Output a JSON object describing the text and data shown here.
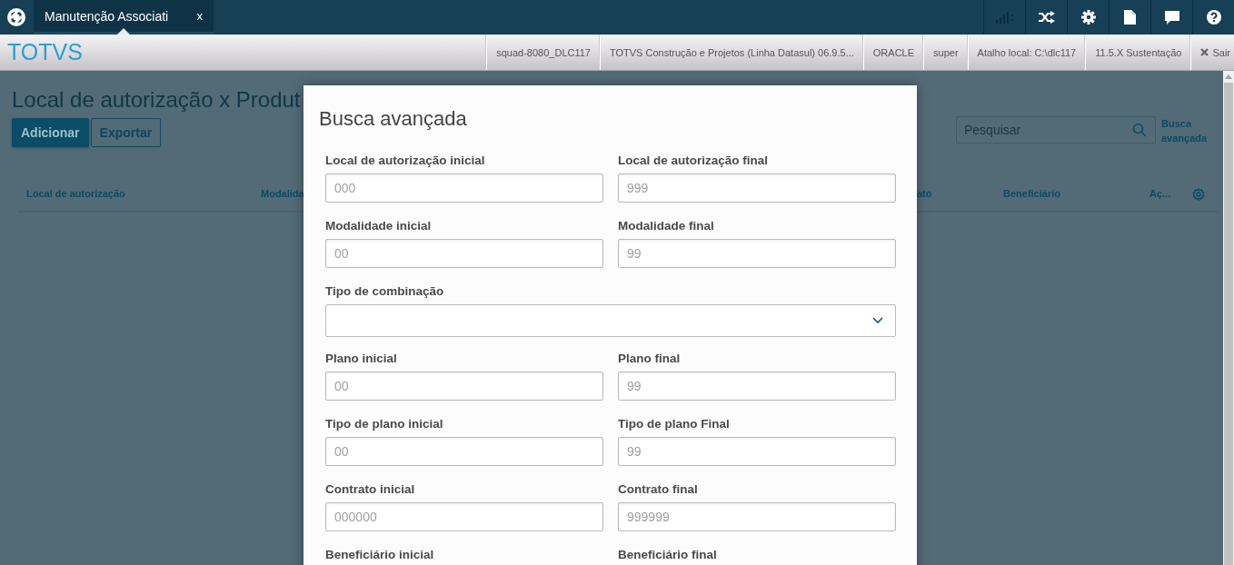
{
  "top_bar": {
    "tabs": [
      {
        "label": "Manutenção Associati",
        "close": "x",
        "selected": true
      }
    ]
  },
  "info_bar": {
    "brand": "TOTVS",
    "items": [
      "squad-8080_DLC117",
      "TOTVS Construção e Projetos (Linha Datasul) 06.9.5...",
      "ORACLE",
      "super",
      "Atalho local: C:\\dlc117",
      "11.5.X Sustentação"
    ],
    "logout": "Sair"
  },
  "page": {
    "title": "Local de autorização x Produt",
    "actions": [
      {
        "label": "Adicionar",
        "kind": "primary"
      },
      {
        "label": "Exportar",
        "kind": "secondary"
      }
    ],
    "search": {
      "placeholder": "Pesquisar"
    },
    "advanced_link": "Busca avançada",
    "table": {
      "columns": [
        "Local de autorização",
        "Modalida",
        "ato",
        "Beneficiário",
        "Aç..."
      ]
    }
  },
  "modal": {
    "title": "Busca avançada",
    "fields": [
      {
        "label": "Local de autorização inicial",
        "placeholder": "000",
        "kind": "text"
      },
      {
        "label": "Local de autorização final",
        "placeholder": "999",
        "kind": "text"
      },
      {
        "label": "Modalidade inicial",
        "placeholder": "00",
        "kind": "text"
      },
      {
        "label": "Modalidade final",
        "placeholder": "99",
        "kind": "text"
      },
      {
        "label": "Tipo de combinação",
        "kind": "select"
      },
      {
        "label": "Plano inicial",
        "placeholder": "00",
        "kind": "text"
      },
      {
        "label": "Plano final",
        "placeholder": "99",
        "kind": "text"
      },
      {
        "label": "Tipo de plano inicial",
        "placeholder": "00",
        "kind": "text"
      },
      {
        "label": "Tipo de plano Final",
        "placeholder": "99",
        "kind": "text"
      },
      {
        "label": "Contrato inicial",
        "placeholder": "000000",
        "kind": "text"
      },
      {
        "label": "Contrato final",
        "placeholder": "999999",
        "kind": "text"
      },
      {
        "label": "Beneficiário inicial",
        "kind": "label"
      },
      {
        "label": "Beneficiário final",
        "kind": "label"
      }
    ]
  }
}
